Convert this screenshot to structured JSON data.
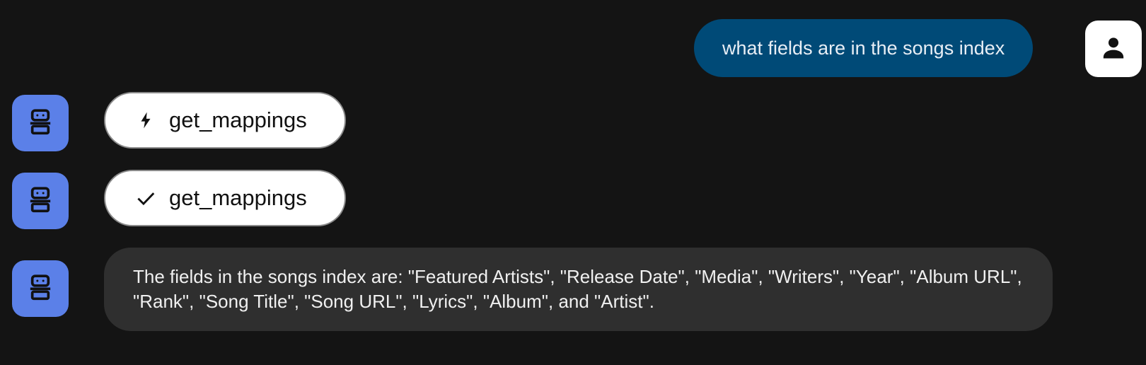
{
  "conversation": {
    "user_message": "what fields are in the songs index",
    "tool_call": {
      "icon": "bolt-icon",
      "label": "get_mappings"
    },
    "tool_result": {
      "icon": "check-icon",
      "label": "get_mappings"
    },
    "assistant_message": "The fields in the songs index are: \"Featured Artists\", \"Release Date\", \"Media\", \"Writers\", \"Year\", \"Album URL\", \"Rank\", \"Song Title\", \"Song URL\", \"Lyrics\", \"Album\", and \"Artist\"."
  },
  "avatars": {
    "user_icon": "person-icon",
    "bot_icon": "robot-icon"
  },
  "colors": {
    "background": "#141414",
    "user_bubble": "#004a77",
    "bot_avatar": "#5b80e8",
    "answer_bubble": "#2f2f2f",
    "tool_pill": "#ffffff"
  }
}
